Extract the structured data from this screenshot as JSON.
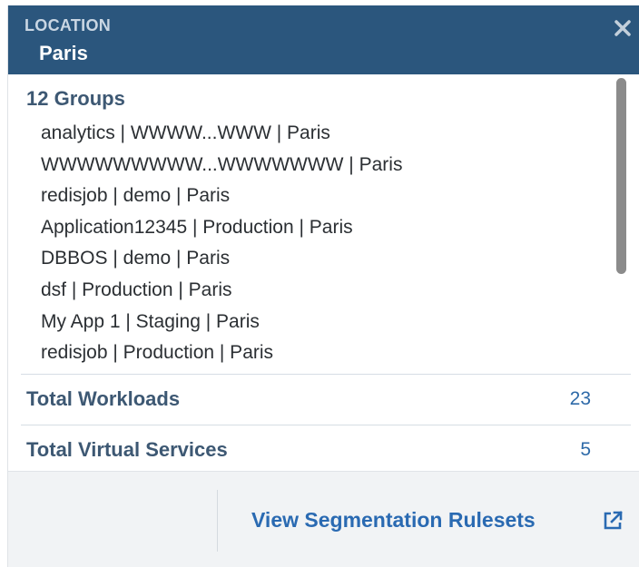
{
  "header": {
    "label": "LOCATION",
    "title": "Paris",
    "close_icon": "close-icon"
  },
  "groups": {
    "title": "12 Groups",
    "items": [
      "analytics | WWWW...WWW | Paris",
      "WWWWWWWWW...WWWWWWW | Paris",
      "redisjob | demo | Paris",
      "Application12345 | Production | Paris",
      "DBBOS | demo | Paris",
      "dsf | Production | Paris",
      "My App 1 | Staging | Paris",
      "redisjob | Production | Paris"
    ]
  },
  "stats": {
    "workloads": {
      "label": "Total Workloads",
      "value": "23"
    },
    "virtual_services": {
      "label": "Total Virtual Services",
      "value": "5"
    }
  },
  "footer": {
    "link_label": "View Segmentation Rulesets",
    "link_icon": "external-link-icon"
  },
  "colors": {
    "header_bg": "#2b567d",
    "accent": "#2a6ab2",
    "label": "#3d5873"
  }
}
